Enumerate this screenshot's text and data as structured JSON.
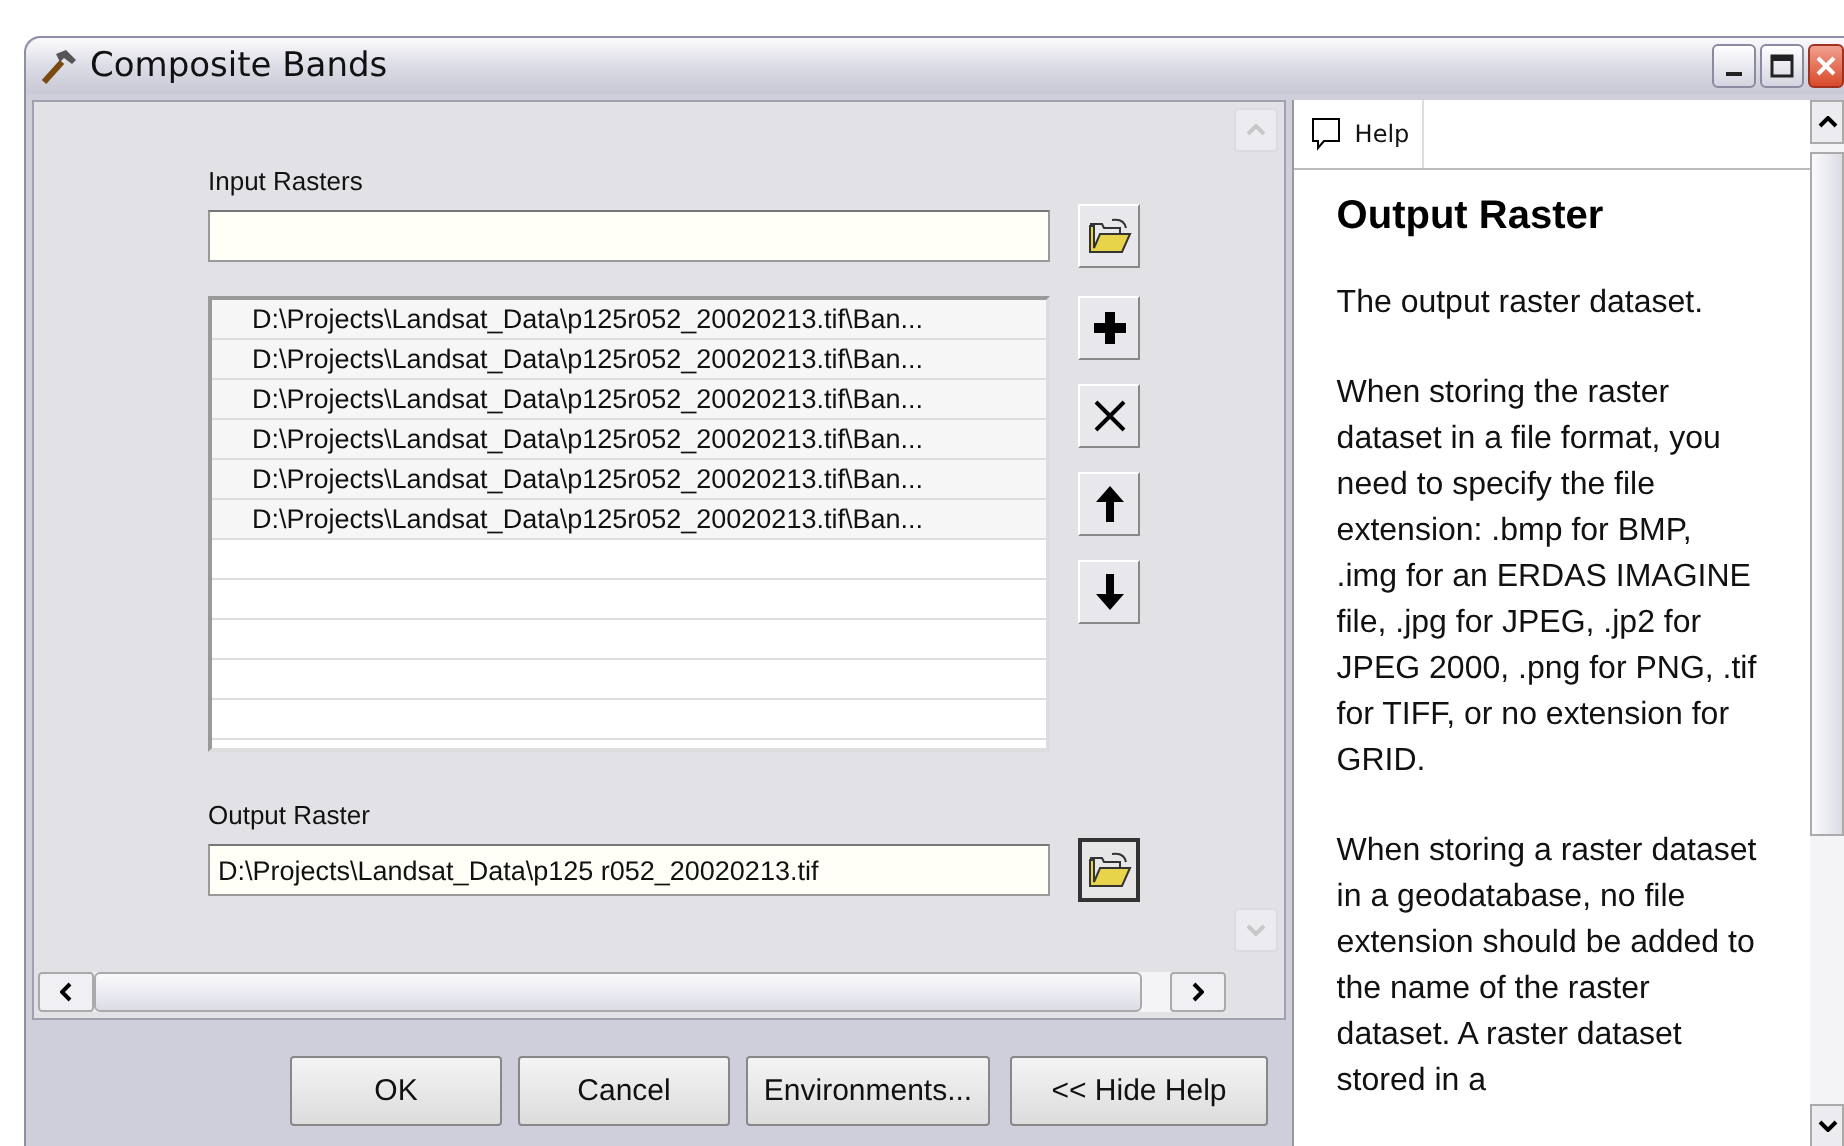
{
  "window": {
    "title": "Composite Bands"
  },
  "input_rasters": {
    "label": "Input Rasters"
  },
  "raster_list": {
    "items": [
      "D:\\Projects\\Landsat_Data\\p125r052_20020213.tif\\Ban...",
      "D:\\Projects\\Landsat_Data\\p125r052_20020213.tif\\Ban...",
      "D:\\Projects\\Landsat_Data\\p125r052_20020213.tif\\Ban...",
      "D:\\Projects\\Landsat_Data\\p125r052_20020213.tif\\Ban...",
      "D:\\Projects\\Landsat_Data\\p125r052_20020213.tif\\Ban...",
      "D:\\Projects\\Landsat_Data\\p125r052_20020213.tif\\Ban..."
    ]
  },
  "output_raster": {
    "label": "Output Raster",
    "value": "D:\\Projects\\Landsat_Data\\p125 r052_20020213.tif"
  },
  "buttons": [
    "OK",
    "Cancel",
    "Environments...",
    "<< Hide Help"
  ],
  "help": {
    "tab": "Help",
    "title": "Output Raster",
    "paragraphs": [
      "The output raster dataset.",
      "When storing the raster dataset in a file format, you need to specify the file extension: .bmp for BMP, .img for an ERDAS IMAGINE file, .jpg for JPEG, .jp2 for JPEG 2000, .png for PNG, .tif for TIFF, or no extension for GRID.",
      "When storing a raster dataset in a geodatabase, no file extension should be added to the name of the raster dataset. A raster dataset stored in a"
    ]
  }
}
